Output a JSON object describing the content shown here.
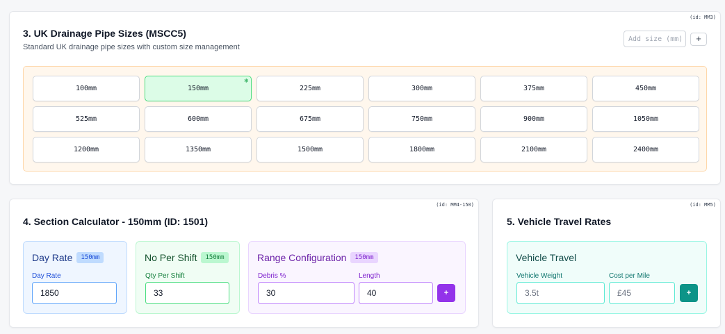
{
  "mm3": {
    "id_label": "(id: MM3)",
    "title": "3. UK Drainage Pipe Sizes (MSCC5)",
    "subtitle": "Standard UK drainage pipe sizes with custom size management",
    "add_size_placeholder": "Add size (mm)",
    "add_button": "+",
    "sizes": [
      "100mm",
      "150mm",
      "225mm",
      "300mm",
      "375mm",
      "450mm",
      "525mm",
      "600mm",
      "675mm",
      "750mm",
      "900mm",
      "1050mm",
      "1200mm",
      "1350mm",
      "1500mm",
      "1800mm",
      "2100mm",
      "2400mm"
    ],
    "selected_size": "150mm",
    "selected_icon": "snowflake-icon",
    "selected_glyph": "❄"
  },
  "mm4": {
    "id_label": "(id: MM4-150)",
    "title": "4. Section Calculator - 150mm (ID: 1501)",
    "day_rate": {
      "title": "Day Rate",
      "badge": "150mm",
      "label": "Day Rate",
      "value": "1850"
    },
    "no_per_shift": {
      "title": "No Per Shift",
      "badge": "150mm",
      "label": "Qty Per Shift",
      "value": "33"
    },
    "range": {
      "title": "Range Configuration",
      "badge": "150mm",
      "debris_label": "Debris %",
      "debris_value": "30",
      "length_label": "Length",
      "length_value": "40",
      "add_button": "+"
    }
  },
  "mm5": {
    "id_label": "(id: MM5)",
    "title": "5. Vehicle Travel Rates",
    "panel_title": "Vehicle Travel",
    "weight_label": "Vehicle Weight",
    "weight_placeholder": "3.5t",
    "cost_label": "Cost per Mile",
    "cost_placeholder": "£45",
    "add_button": "+"
  },
  "colors": {
    "selected_size_bg": "#dcfce7",
    "range_accent": "#9333ea",
    "vehicle_accent": "#0d9488"
  }
}
